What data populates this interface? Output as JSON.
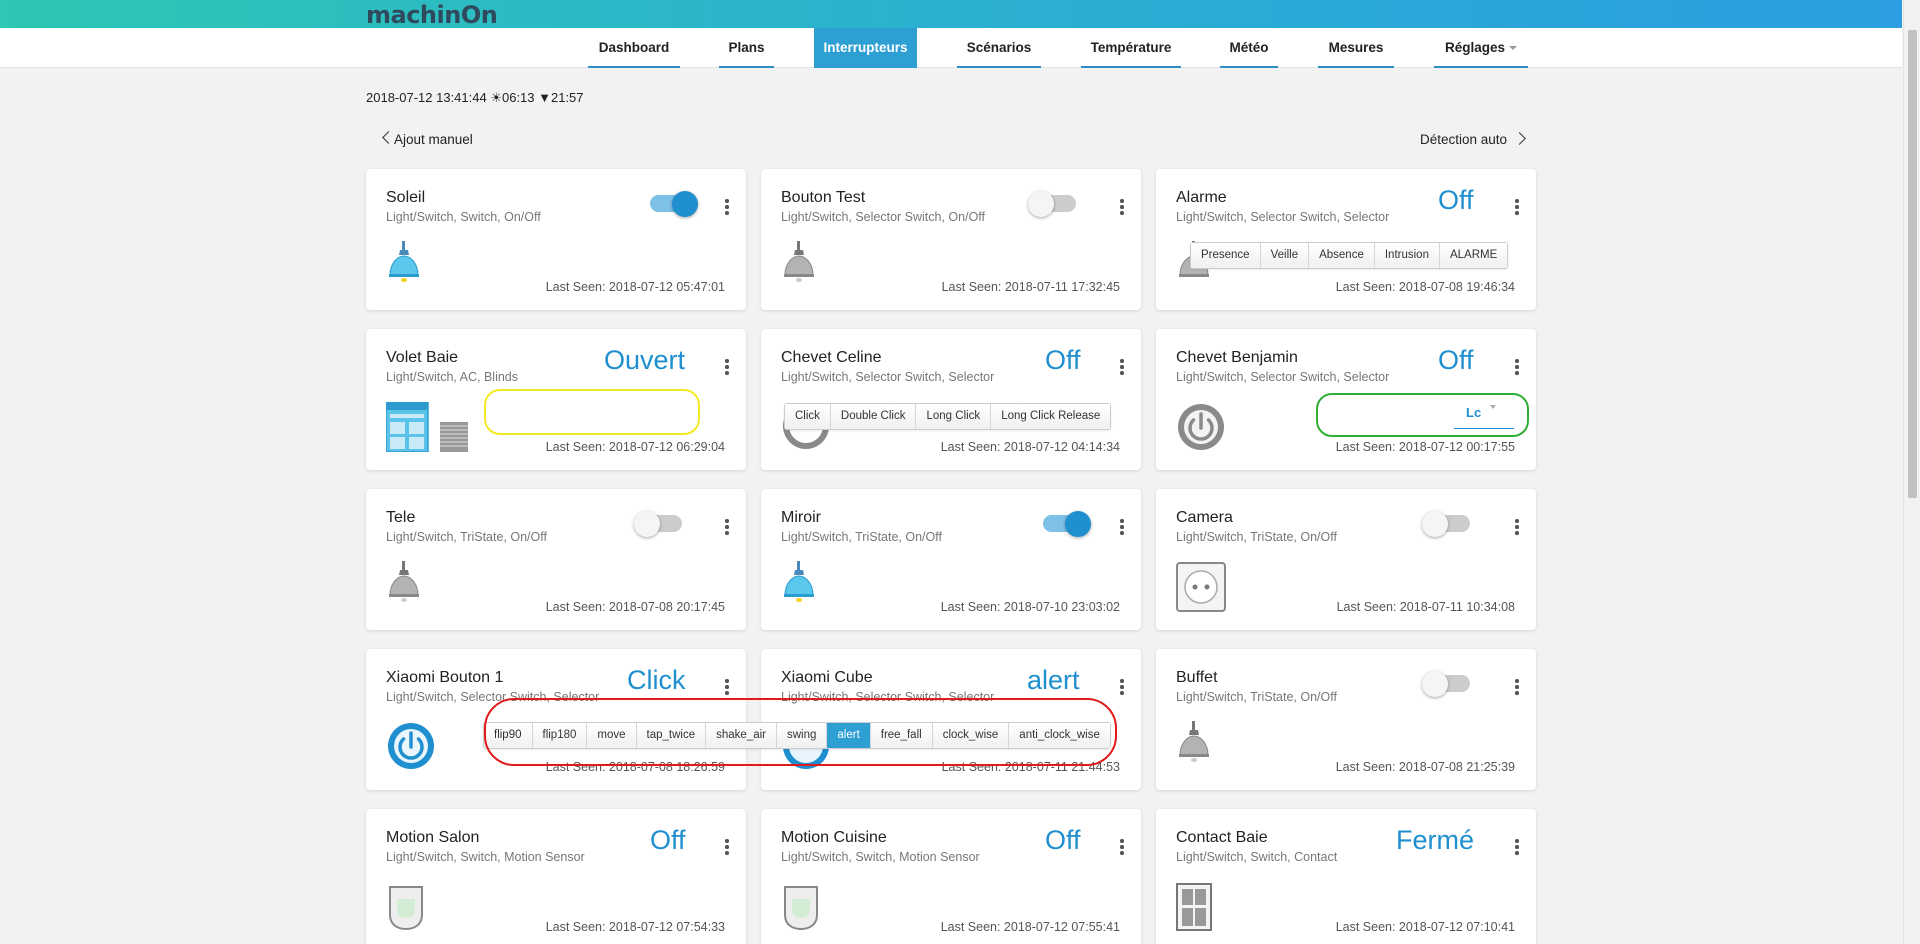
{
  "app": {
    "logo": "machinOn"
  },
  "nav": [
    {
      "label": "Dashboard",
      "active": false
    },
    {
      "label": "Plans",
      "active": false
    },
    {
      "label": "Interrupteurs",
      "active": true
    },
    {
      "label": "Scénarios",
      "active": false
    },
    {
      "label": "Température",
      "active": false
    },
    {
      "label": "Météo",
      "active": false
    },
    {
      "label": "Mesures",
      "active": false
    },
    {
      "label": "Réglages",
      "active": false,
      "dropdown": true
    }
  ],
  "header": {
    "datetime": "2018-07-12 13:41:44 ☀06:13 ▼21:57",
    "manual_add": "Ajout manuel",
    "auto_detect": "Détection auto"
  },
  "devices": [
    {
      "name": "Soleil",
      "type": "Light/Switch, Switch, On/Off",
      "control": "toggle",
      "state": "on",
      "icon": "bulb-on-icon",
      "last_seen": "Last Seen: 2018-07-12 05:47:01"
    },
    {
      "name": "Bouton Test",
      "type": "Light/Switch, Selector Switch, On/Off",
      "control": "toggle",
      "state": "off",
      "icon": "bulb-off-icon",
      "last_seen": "Last Seen: 2018-07-11 17:32:45"
    },
    {
      "name": "Alarme",
      "type": "Light/Switch, Selector Switch, Selector",
      "status": "Off",
      "icon": "bulb-off-icon",
      "last_seen": "Last Seen: 2018-07-08 19:46:34",
      "options": [
        "Presence",
        "Veille",
        "Absence",
        "Intrusion",
        "ALARME"
      ]
    },
    {
      "name": "Volet Baie",
      "type": "Light/Switch, AC, Blinds",
      "status": "Ouvert",
      "icon": "blinds-icon",
      "last_seen": "Last Seen: 2018-07-12 06:29:04"
    },
    {
      "name": "Chevet Celine",
      "type": "Light/Switch, Selector Switch, Selector",
      "status": "Off",
      "icon": "power-icon",
      "last_seen": "Last Seen: 2018-07-12 04:14:34",
      "options": [
        "Click",
        "Double Click",
        "Long Click",
        "Long Click Release"
      ]
    },
    {
      "name": "Chevet Benjamin",
      "type": "Light/Switch, Selector Switch, Selector",
      "status": "Off",
      "icon": "power-icon",
      "last_seen": "Last Seen: 2018-07-12 00:17:55",
      "select_value": "Lc"
    },
    {
      "name": "Tele",
      "type": "Light/Switch, TriState, On/Off",
      "control": "toggle",
      "state": "off",
      "icon": "bulb-off-icon",
      "last_seen": "Last Seen: 2018-07-08 20:17:45"
    },
    {
      "name": "Miroir",
      "type": "Light/Switch, TriState, On/Off",
      "control": "toggle",
      "state": "on",
      "icon": "bulb-on-icon",
      "last_seen": "Last Seen: 2018-07-10 23:03:02"
    },
    {
      "name": "Camera",
      "type": "Light/Switch, TriState, On/Off",
      "control": "toggle",
      "state": "off",
      "icon": "outlet-icon",
      "last_seen": "Last Seen: 2018-07-11 10:34:08"
    },
    {
      "name": "Xiaomi Bouton 1",
      "type": "Light/Switch, Selector Switch, Selector",
      "status": "Click",
      "icon": "power-on-icon",
      "last_seen": "Last Seen: 2018-07-08 18:26:59"
    },
    {
      "name": "Xiaomi Cube",
      "type": "Light/Switch, Selector Switch, Selector",
      "status": "alert",
      "icon": "power-on-icon",
      "last_seen": "Last Seen: 2018-07-11 21:44:53"
    },
    {
      "name": "Buffet",
      "type": "Light/Switch, TriState, On/Off",
      "control": "toggle",
      "state": "off",
      "icon": "bulb-off-icon",
      "last_seen": "Last Seen: 2018-07-08 21:25:39"
    },
    {
      "name": "Motion Salon",
      "type": "Light/Switch, Switch, Motion Sensor",
      "status": "Off",
      "icon": "motion-sensor-icon",
      "last_seen": "Last Seen: 2018-07-12 07:54:33"
    },
    {
      "name": "Motion Cuisine",
      "type": "Light/Switch, Switch, Motion Sensor",
      "status": "Off",
      "icon": "motion-sensor-icon",
      "last_seen": "Last Seen: 2018-07-12 07:55:41"
    },
    {
      "name": "Contact Baie",
      "type": "Light/Switch, Switch, Contact",
      "status": "Fermé",
      "icon": "door-icon",
      "last_seen": "Last Seen: 2018-07-12 07:10:41"
    }
  ],
  "cube_options": [
    "flip90",
    "flip180",
    "move",
    "tap_twice",
    "shake_air",
    "swing",
    "alert",
    "free_fall",
    "clock_wise",
    "anti_clock_wise"
  ],
  "cube_selected": "alert",
  "colors": {
    "accent": "#1f8fcf",
    "highlight_yellow": "#f4ea23",
    "highlight_green": "#2fae35",
    "highlight_red": "#e01b1b"
  }
}
